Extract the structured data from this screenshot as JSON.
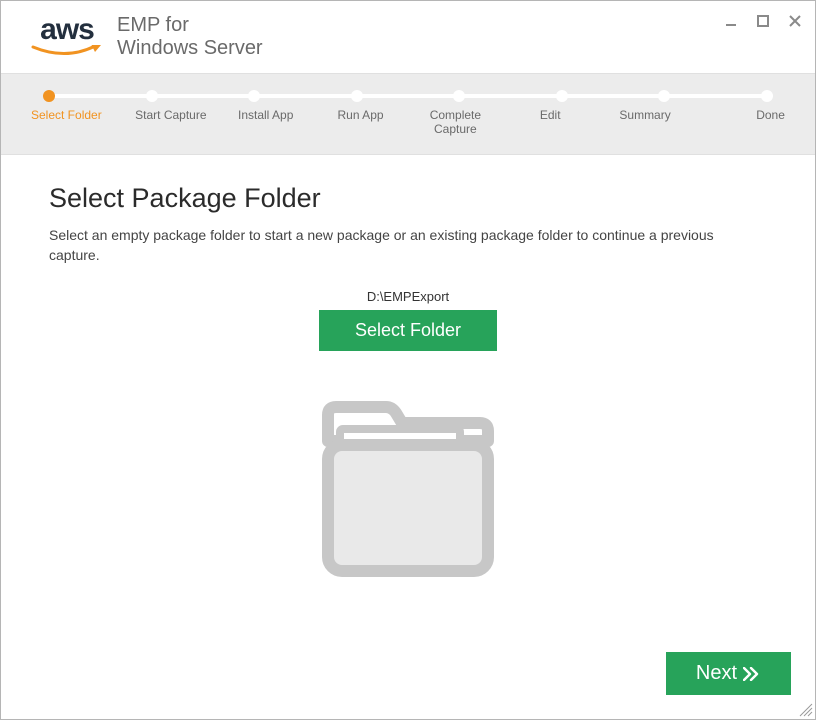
{
  "header": {
    "logo_text": "aws",
    "app_title_line1": "EMP for",
    "app_title_line2": "Windows Server"
  },
  "stepper": {
    "active_index": 0,
    "steps": [
      {
        "label": "Select Folder"
      },
      {
        "label": "Start Capture"
      },
      {
        "label": "Install App"
      },
      {
        "label": "Run App"
      },
      {
        "label": "Complete Capture"
      },
      {
        "label": "Edit"
      },
      {
        "label": "Summary"
      },
      {
        "label": "Done"
      }
    ]
  },
  "main": {
    "title": "Select Package Folder",
    "description": "Select an empty package folder to start a new package or an existing package folder to continue a previous capture.",
    "folder_path": "D:\\EMPExport",
    "select_button_label": "Select Folder"
  },
  "footer": {
    "next_label": "Next"
  },
  "colors": {
    "accent_orange": "#f19321",
    "primary_green": "#27a35a"
  }
}
